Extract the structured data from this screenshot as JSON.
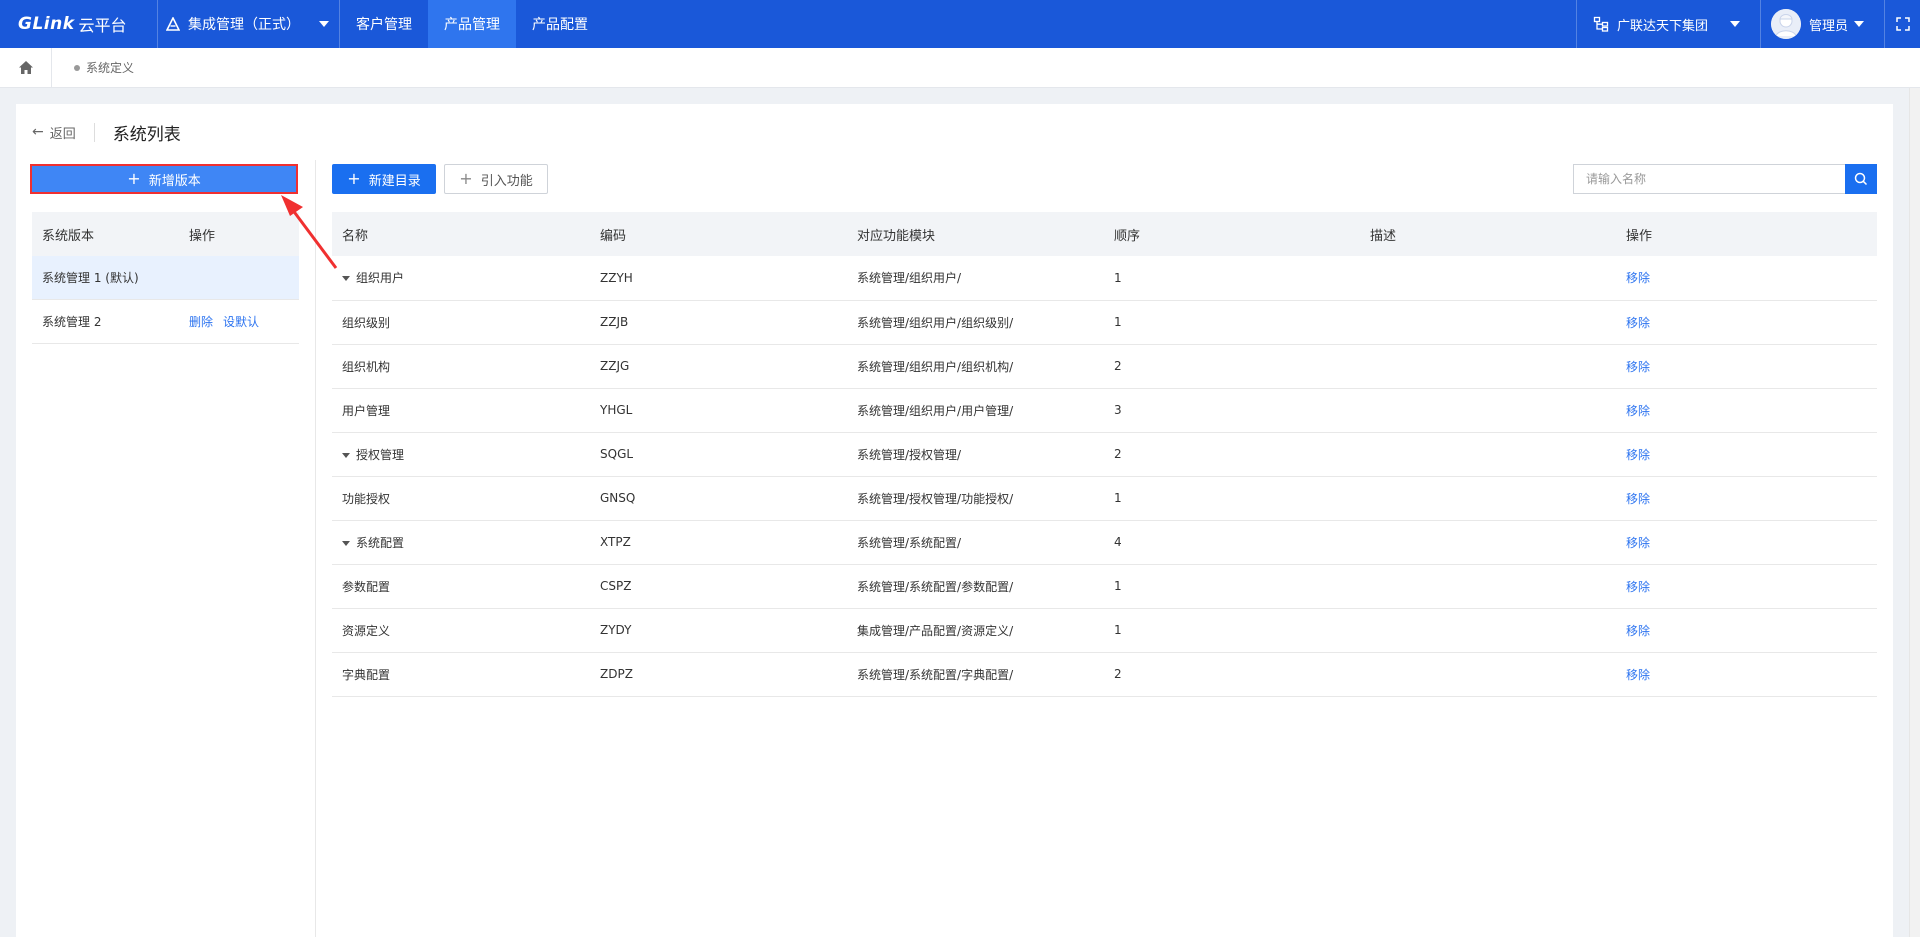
{
  "topbar": {
    "brand": "GLink",
    "brand_cn": "云平台",
    "app_switch": "集成管理（正式）",
    "nav": [
      {
        "label": "客户管理",
        "active": false
      },
      {
        "label": "产品管理",
        "active": true
      },
      {
        "label": "产品配置",
        "active": false
      }
    ],
    "org": "广联达天下集团",
    "user": "管理员"
  },
  "breadcrumb": {
    "current": "系统定义"
  },
  "page": {
    "back_label": "返回",
    "title": "系统列表"
  },
  "left": {
    "add_button": "新增版本",
    "headers": {
      "version": "系统版本",
      "action": "操作"
    },
    "rows": [
      {
        "name": "系统管理 1 (默认)",
        "selected": true,
        "delete": "",
        "set_default": ""
      },
      {
        "name": "系统管理 2",
        "selected": false,
        "delete": "删除",
        "set_default": "设默认"
      }
    ]
  },
  "right": {
    "new_dir_button": "新建目录",
    "import_button": "引入功能",
    "search_placeholder": "请输入名称",
    "headers": {
      "name": "名称",
      "code": "编码",
      "module": "对应功能模块",
      "order": "顺序",
      "desc": "描述",
      "action": "操作"
    },
    "rows": [
      {
        "name": "组织用户",
        "code": "ZZYH",
        "module": "系统管理/组织用户/",
        "order": "1",
        "desc": "",
        "action": "移除",
        "level": 0
      },
      {
        "name": "组织级别",
        "code": "ZZJB",
        "module": "系统管理/组织用户/组织级别/",
        "order": "1",
        "desc": "",
        "action": "移除",
        "level": 1
      },
      {
        "name": "组织机构",
        "code": "ZZJG",
        "module": "系统管理/组织用户/组织机构/",
        "order": "2",
        "desc": "",
        "action": "移除",
        "level": 1
      },
      {
        "name": "用户管理",
        "code": "YHGL",
        "module": "系统管理/组织用户/用户管理/",
        "order": "3",
        "desc": "",
        "action": "移除",
        "level": 1
      },
      {
        "name": "授权管理",
        "code": "SQGL",
        "module": "系统管理/授权管理/",
        "order": "2",
        "desc": "",
        "action": "移除",
        "level": 0
      },
      {
        "name": "功能授权",
        "code": "GNSQ",
        "module": "系统管理/授权管理/功能授权/",
        "order": "1",
        "desc": "",
        "action": "移除",
        "level": 1
      },
      {
        "name": "系统配置",
        "code": "XTPZ",
        "module": "系统管理/系统配置/",
        "order": "4",
        "desc": "",
        "action": "移除",
        "level": 0
      },
      {
        "name": "参数配置",
        "code": "CSPZ",
        "module": "系统管理/系统配置/参数配置/",
        "order": "1",
        "desc": "",
        "action": "移除",
        "level": 1
      },
      {
        "name": "资源定义",
        "code": "ZYDY",
        "module": "集成管理/产品配置/资源定义/",
        "order": "1",
        "desc": "",
        "action": "移除",
        "level": 1
      },
      {
        "name": "字典配置",
        "code": "ZDPZ",
        "module": "系统管理/系统配置/字典配置/",
        "order": "2",
        "desc": "",
        "action": "移除",
        "level": 1
      }
    ]
  },
  "colors": {
    "topbar": "#1a58d9",
    "nav_active": "#2f75ee",
    "primary": "#1a6ff0",
    "link": "#2d74f0",
    "annotation": "#f03030"
  }
}
